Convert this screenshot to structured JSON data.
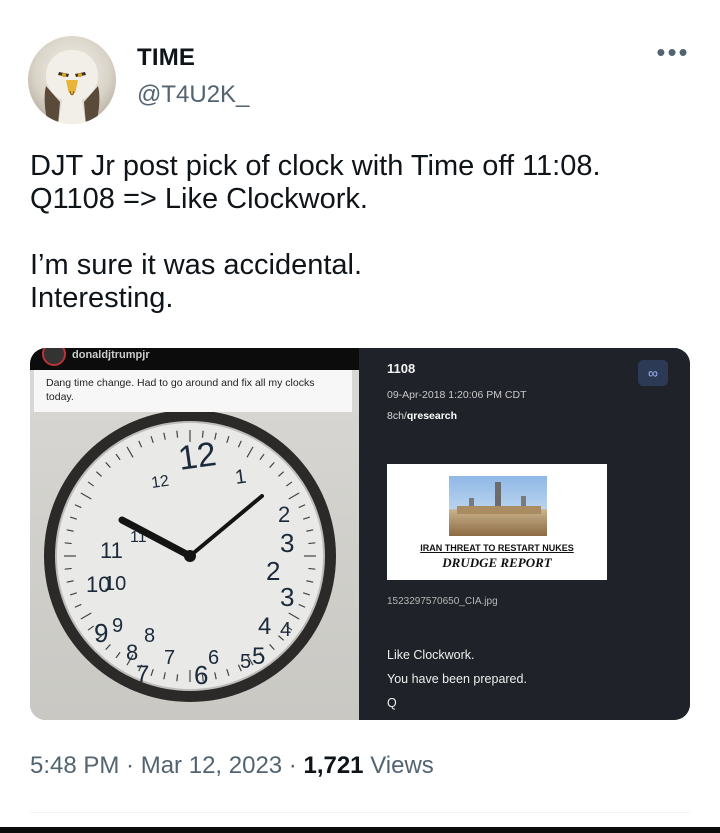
{
  "author": {
    "display_name": "TIME",
    "handle": "@T4U2K_",
    "avatar_icon": "eagle-avatar"
  },
  "menu": {
    "more_label": "•••"
  },
  "tweet": {
    "lines_para1": [
      "DJT Jr post pick of clock with Time off 11:08.",
      "Q1108 => Like Clockwork."
    ],
    "lines_para2": [
      "I’m sure it was accidental.",
      "Interesting."
    ]
  },
  "media": {
    "left": {
      "instagram_user": "donaldjtrumpjr",
      "caption": "Dang time change. Had to go around and fix all my clocks today.",
      "clock_numbers": [
        "12",
        "12",
        "1",
        "2",
        "3",
        "2",
        "3",
        "4",
        "4",
        "5",
        "5",
        "6",
        "6",
        "7",
        "7",
        "8",
        "8",
        "9",
        "9",
        "10",
        "10",
        "11",
        "11"
      ]
    },
    "right": {
      "post_number": "1108",
      "timestamp": "09-Apr-2018 1:20:06 PM CDT",
      "board_prefix": "8ch/",
      "board_name": "qresearch",
      "headline": "IRAN THREAT TO RESTART NUKES",
      "brand": "DRUDGE REPORT",
      "filename": "1523297570650_CIA.jpg",
      "message_lines": [
        "Like Clockwork.",
        "You have been prepared.",
        "Q"
      ],
      "link_icon": "link-icon"
    }
  },
  "footer": {
    "time": "5:48 PM",
    "sep1": " · ",
    "date": "Mar 12, 2023",
    "sep2": " · ",
    "views_count": "1,721",
    "views_label": " Views"
  }
}
